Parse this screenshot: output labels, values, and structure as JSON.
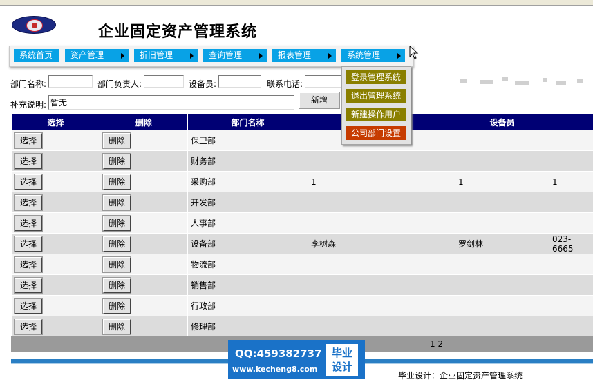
{
  "header": {
    "title": "企业固定资产管理系统"
  },
  "nav": {
    "items": [
      {
        "label": "系统首页"
      },
      {
        "label": "资产管理"
      },
      {
        "label": "折旧管理"
      },
      {
        "label": "查询管理"
      },
      {
        "label": "报表管理"
      },
      {
        "label": "系统管理"
      }
    ]
  },
  "dropdown": {
    "items": [
      {
        "label": "登录管理系统"
      },
      {
        "label": "退出管理系统"
      },
      {
        "label": "新建操作用户"
      },
      {
        "label": "公司部门设置"
      }
    ]
  },
  "form": {
    "dept_name_label": "部门名称:",
    "dept_head_label": "部门负责人:",
    "equip_label": "设备员:",
    "phone_label": "联系电话:",
    "note_label": "补充说明:",
    "note_value": "暂无",
    "add_label": "新增"
  },
  "table": {
    "headers": [
      "选择",
      "删除",
      "部门名称",
      "",
      "设备员",
      ""
    ],
    "select_label": "选择",
    "delete_label": "删除",
    "rows": [
      {
        "dept": "保卫部",
        "head": "",
        "equip": "",
        "phone": ""
      },
      {
        "dept": "财务部",
        "head": "",
        "equip": "",
        "phone": ""
      },
      {
        "dept": "采购部",
        "head": "1",
        "equip": "1",
        "phone": "1"
      },
      {
        "dept": "开发部",
        "head": "",
        "equip": "",
        "phone": ""
      },
      {
        "dept": "人事部",
        "head": "",
        "equip": "",
        "phone": ""
      },
      {
        "dept": "设备部",
        "head": "李树森",
        "equip": "罗剑林",
        "phone": "023-6665"
      },
      {
        "dept": "物流部",
        "head": "",
        "equip": "",
        "phone": ""
      },
      {
        "dept": "销售部",
        "head": "",
        "equip": "",
        "phone": ""
      },
      {
        "dept": "行政部",
        "head": "",
        "equip": "",
        "phone": ""
      },
      {
        "dept": "修理部",
        "head": "",
        "equip": "",
        "phone": ""
      }
    ]
  },
  "pager": {
    "pages": "1 2"
  },
  "footer": {
    "text": "毕业设计：企业固定资产管理系统"
  },
  "watermark": {
    "qq": "QQ:459382737",
    "url": "www.kecheng8.com",
    "tag_line1": "毕业",
    "tag_line2": "设计"
  },
  "colors": {
    "nav_blue": "#08a2e6",
    "table_header": "#000074",
    "menu_olive": "#8a7f00",
    "menu_active": "#c63b00"
  }
}
